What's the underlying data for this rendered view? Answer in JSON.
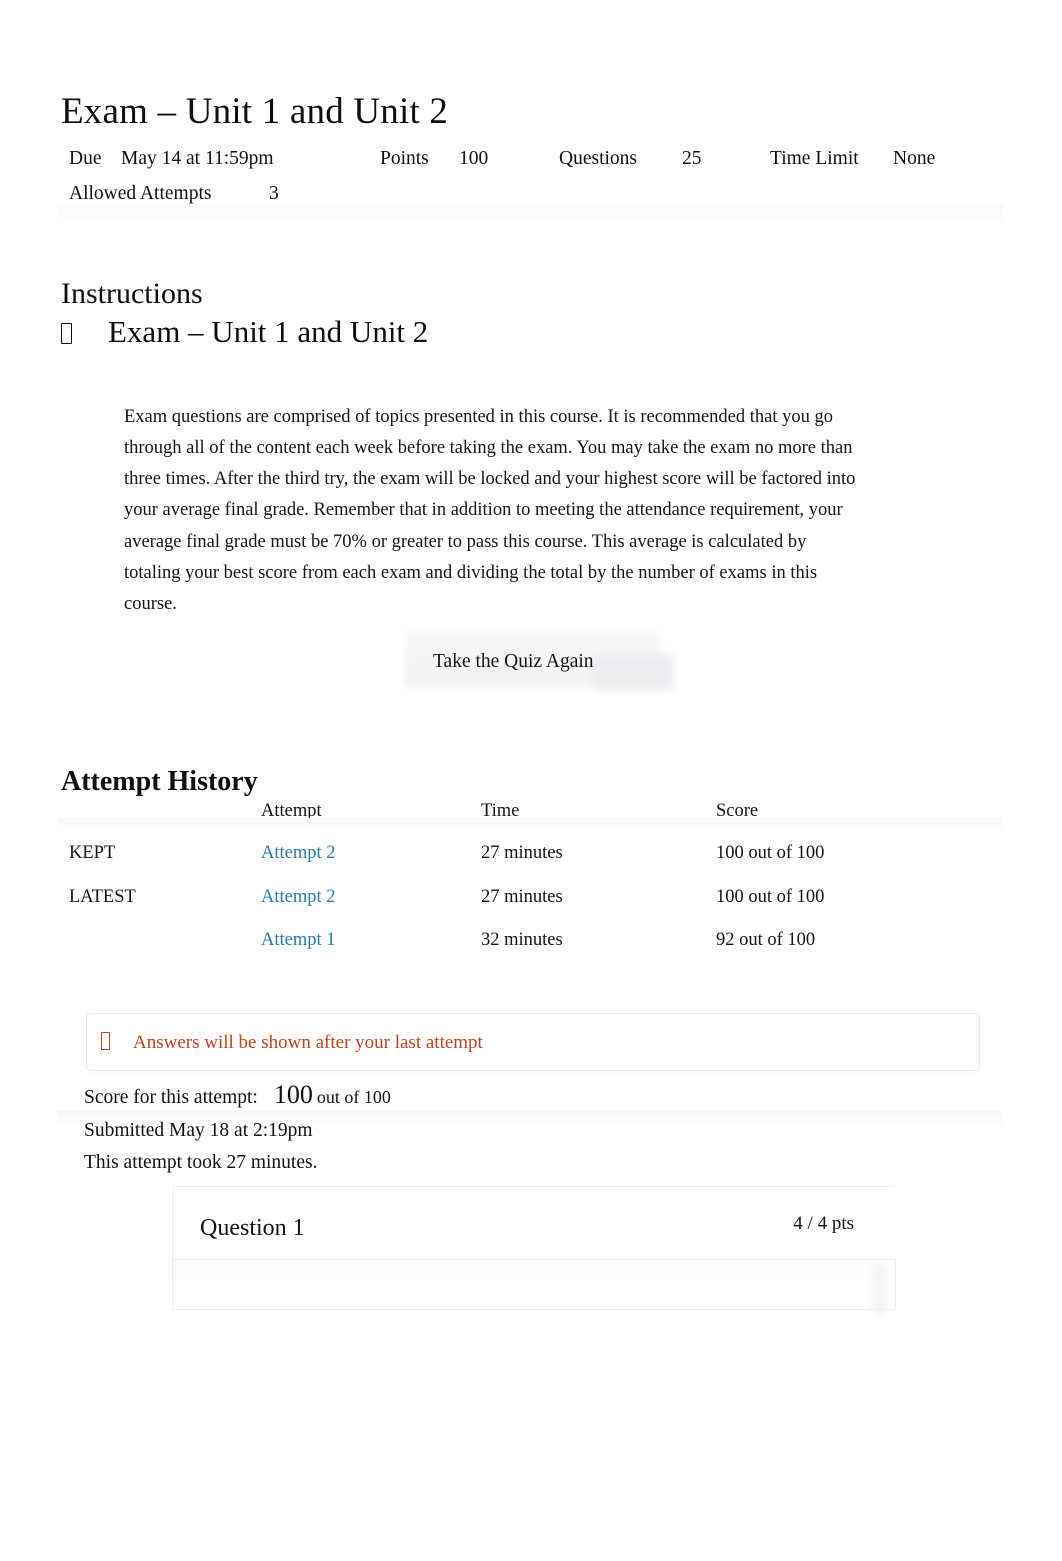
{
  "quiz": {
    "title": "Exam – Unit 1 and Unit 2",
    "meta": {
      "due_label": "Due",
      "due_value": "May 14 at 11:59pm",
      "points_label": "Points",
      "points_value": "100",
      "questions_label": "Questions",
      "questions_value": "25",
      "time_limit_label": "Time Limit",
      "time_limit_value": "None",
      "allowed_attempts_label": "Allowed Attempts",
      "allowed_attempts_value": "3"
    }
  },
  "instructions": {
    "heading": "Instructions",
    "subheading": "Exam – Unit 1 and Unit 2",
    "body": "Exam questions are comprised of topics presented in this course. It is recommended that you go through all of the content each week before taking the exam. You may take the exam no more than three times. After the third try, the exam will be locked and your highest score will be factored into your average final grade. Remember that in addition to meeting the attendance requirement, your average final grade must be 70% or greater to pass this course. This average is calculated by totaling your best score from each exam and dividing the total by the number of exams in this course."
  },
  "take_quiz_again_button": {
    "label": "Take the Quiz Again"
  },
  "attempt_history": {
    "heading": "Attempt History",
    "columns": [
      "",
      "Attempt",
      "Time",
      "Score"
    ],
    "rows": [
      {
        "status": "KEPT",
        "attempt": "Attempt 2",
        "time": "27 minutes",
        "score": "100 out of 100"
      },
      {
        "status": "LATEST",
        "attempt": "Attempt 2",
        "time": "27 minutes",
        "score": "100 out of 100"
      },
      {
        "status": "",
        "attempt": "Attempt 1",
        "time": "32 minutes",
        "score": "92 out of 100"
      }
    ]
  },
  "notice": {
    "text": "Answers will be shown after your last attempt",
    "color": "#c0421b"
  },
  "attempt_summary": {
    "score_label": "Score for this attempt:",
    "score_value": "100",
    "score_out_of": "out of 100",
    "submitted": "Submitted May 18 at 2:19pm",
    "duration": "This attempt took 27 minutes."
  },
  "question": {
    "title": "Question 1",
    "points": "4 / 4 pts"
  },
  "colors": {
    "link": "#2a7ba8",
    "notice": "#c0421b",
    "text": "#111111"
  }
}
